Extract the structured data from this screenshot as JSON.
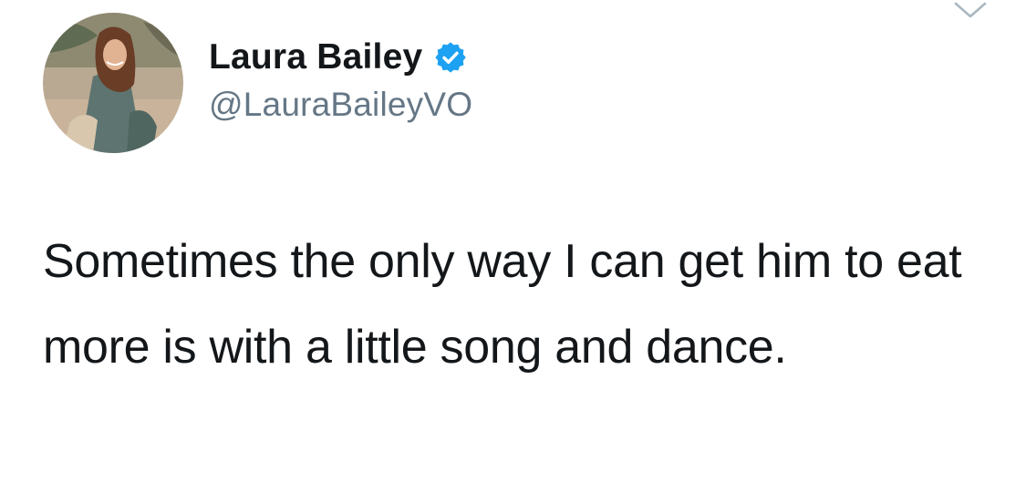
{
  "author": {
    "display_name": "Laura Bailey",
    "handle": "@LauraBaileyVO",
    "verified": true,
    "avatar_icon": "profile-photo"
  },
  "tweet": {
    "text": "Sometimes the only way I can get him to eat more is with a little song and dance."
  },
  "menu": {
    "icon": "chevron-down-icon"
  },
  "colors": {
    "text": "#14171a",
    "handle": "#657786",
    "verified_blue": "#1da1f2",
    "chevron": "#aab8c2"
  }
}
